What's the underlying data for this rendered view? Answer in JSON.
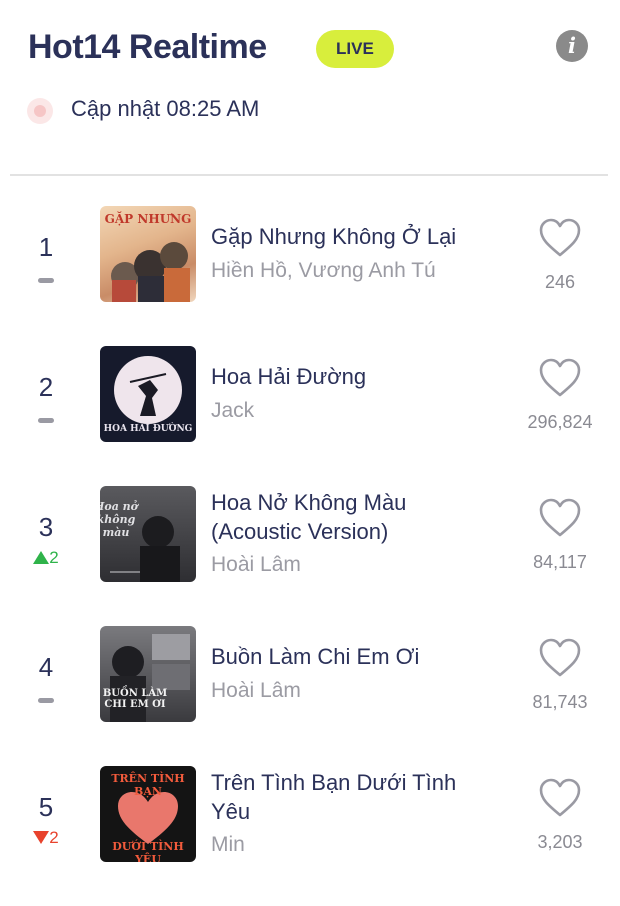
{
  "header": {
    "title": "Hot14 Realtime",
    "live_badge": "LIVE",
    "info_icon": "info-icon",
    "updated": "Cập nhật 08:25 AM"
  },
  "colors": {
    "title": "#2b3159",
    "live_badge": "#d8ee3c",
    "rank_up": "#2fb34a",
    "rank_down": "#e8432d"
  },
  "songs": [
    {
      "rank": "1",
      "change": "",
      "song": "Gặp Nhưng Không Ở Lại",
      "artist": "Hiền Hồ, Vương Anh Tú",
      "likes": "246",
      "art_text": "GẶP NHƯNG"
    },
    {
      "rank": "2",
      "change": "",
      "song": "Hoa Hải Đường",
      "artist": "Jack",
      "likes": "296,824",
      "art_text": "HOA HẢI ĐƯỜNG"
    },
    {
      "rank": "3",
      "change": "2",
      "song": "Hoa Nở Không Màu (Acoustic Version)",
      "artist": "Hoài Lâm",
      "likes": "84,117",
      "art_text": "Hoa nở không màu"
    },
    {
      "rank": "4",
      "change": "",
      "song": "Buồn Làm Chi Em Ơi",
      "artist": "Hoài Lâm",
      "likes": "81,743",
      "art_text": "BUỒN LÀM CHI EM ƠI"
    },
    {
      "rank": "5",
      "change": "2",
      "song": "Trên Tình Bạn Dưới Tình Yêu",
      "artist": "Min",
      "likes": "3,203",
      "art_text_top": "TRÊN TÌNH BẠN",
      "art_text_bottom": "DƯỚI TÌNH YÊU"
    }
  ]
}
